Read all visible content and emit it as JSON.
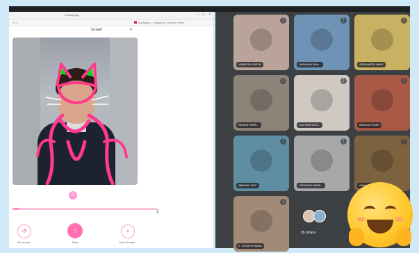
{
  "window": {
    "title": "Scrawlr.app",
    "url_left": "C:/...",
    "url_right": "Instagram - Instagram Camera Filters",
    "toolbar_title": "Scrawlr",
    "menu_caret": "▾"
  },
  "editor": {
    "slider_value": "0",
    "range_max": "2",
    "range_fraction": 0.05,
    "buttons": [
      {
        "icon": "↺",
        "label": "Re-record"
      },
      {
        "icon": "↑",
        "label": "Save"
      },
      {
        "icon": "+",
        "label": "New Scrawlr"
      }
    ]
  },
  "gallery": {
    "tiles": [
      {
        "name": "VINSHITA GUPTA",
        "bg": "#b9a39a"
      },
      {
        "name": "SARANYA SIVA...",
        "bg": "#6e93b4"
      },
      {
        "name": "SIDDHARTH BHAT",
        "bg": "#c9b163"
      },
      {
        "name": "RAJESH SHIR...",
        "bg": "#8c8478"
      },
      {
        "name": "KASTURI GHO...",
        "bg": "#cfc9c2"
      },
      {
        "name": "ANKUSH SHAH",
        "bg": "#a85a47"
      },
      {
        "name": "ABHINAY DEV",
        "bg": "#5f8ea3"
      },
      {
        "name": "VEDANTH BHAR...",
        "bg": "#a7a8aa"
      },
      {
        "name": "ANANYA CHANDRA",
        "bg": "#7d6240"
      },
      {
        "name": "K. SOUMYA SAHA",
        "bg": "#a38a77"
      }
    ],
    "others_label": "26 others"
  },
  "colors": {
    "accent": "#ff6fb2",
    "meet_bg": "#3c4043"
  }
}
